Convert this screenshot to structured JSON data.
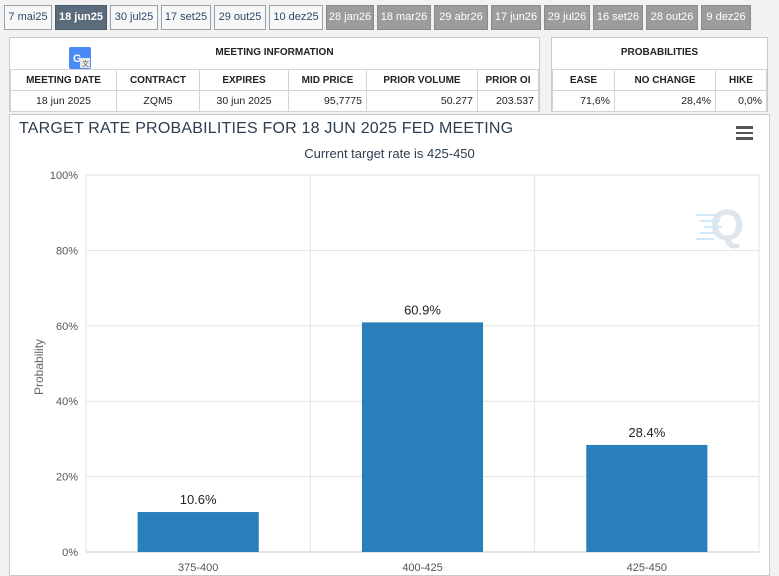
{
  "tabs": [
    {
      "label": "7 mai25",
      "state": "normal"
    },
    {
      "label": "18 jun25",
      "state": "active"
    },
    {
      "label": "30 jul25",
      "state": "normal"
    },
    {
      "label": "17 set25",
      "state": "normal"
    },
    {
      "label": "29 out25",
      "state": "normal"
    },
    {
      "label": "10 dez25",
      "state": "normal"
    },
    {
      "label": "28 jan26",
      "state": "grey"
    },
    {
      "label": "18 mar26",
      "state": "grey"
    },
    {
      "label": "29 abr26",
      "state": "grey"
    },
    {
      "label": "17 jun26",
      "state": "grey"
    },
    {
      "label": "29 jul26",
      "state": "grey"
    },
    {
      "label": "16 set26",
      "state": "grey"
    },
    {
      "label": "28 out26",
      "state": "grey"
    },
    {
      "label": "9 dez26",
      "state": "grey"
    }
  ],
  "meeting": {
    "title": "MEETING INFORMATION",
    "headers": [
      "MEETING DATE",
      "CONTRACT",
      "EXPIRES",
      "MID PRICE",
      "PRIOR VOLUME",
      "PRIOR OI"
    ],
    "values": [
      "18 jun 2025",
      "ZQM5",
      "30 jun 2025",
      "95,7775",
      "50.277",
      "203.537"
    ]
  },
  "probabilities": {
    "title": "PROBABILITIES",
    "headers": [
      "EASE",
      "NO CHANGE",
      "HIKE"
    ],
    "values": [
      "71,6%",
      "28,4%",
      "0,0%"
    ]
  },
  "chart": {
    "title": "TARGET RATE PROBABILITIES FOR 18 JUN 2025 FED MEETING",
    "subtitle": "Current target rate is 425-450",
    "ylabel": "Probability",
    "bar_color": "#2a7fba"
  },
  "chart_data": {
    "type": "bar",
    "title": "TARGET RATE PROBABILITIES FOR 18 JUN 2025 FED MEETING",
    "subtitle": "Current target rate is 425-450",
    "xlabel": "",
    "ylabel": "Probability",
    "categories": [
      "375-400",
      "400-425",
      "425-450"
    ],
    "values": [
      10.6,
      60.9,
      28.4
    ],
    "data_labels": [
      "10.6%",
      "60.9%",
      "28.4%"
    ],
    "ylim": [
      0,
      100
    ],
    "yticks": [
      "0%",
      "20%",
      "40%",
      "60%",
      "80%",
      "100%"
    ],
    "grid": true
  }
}
